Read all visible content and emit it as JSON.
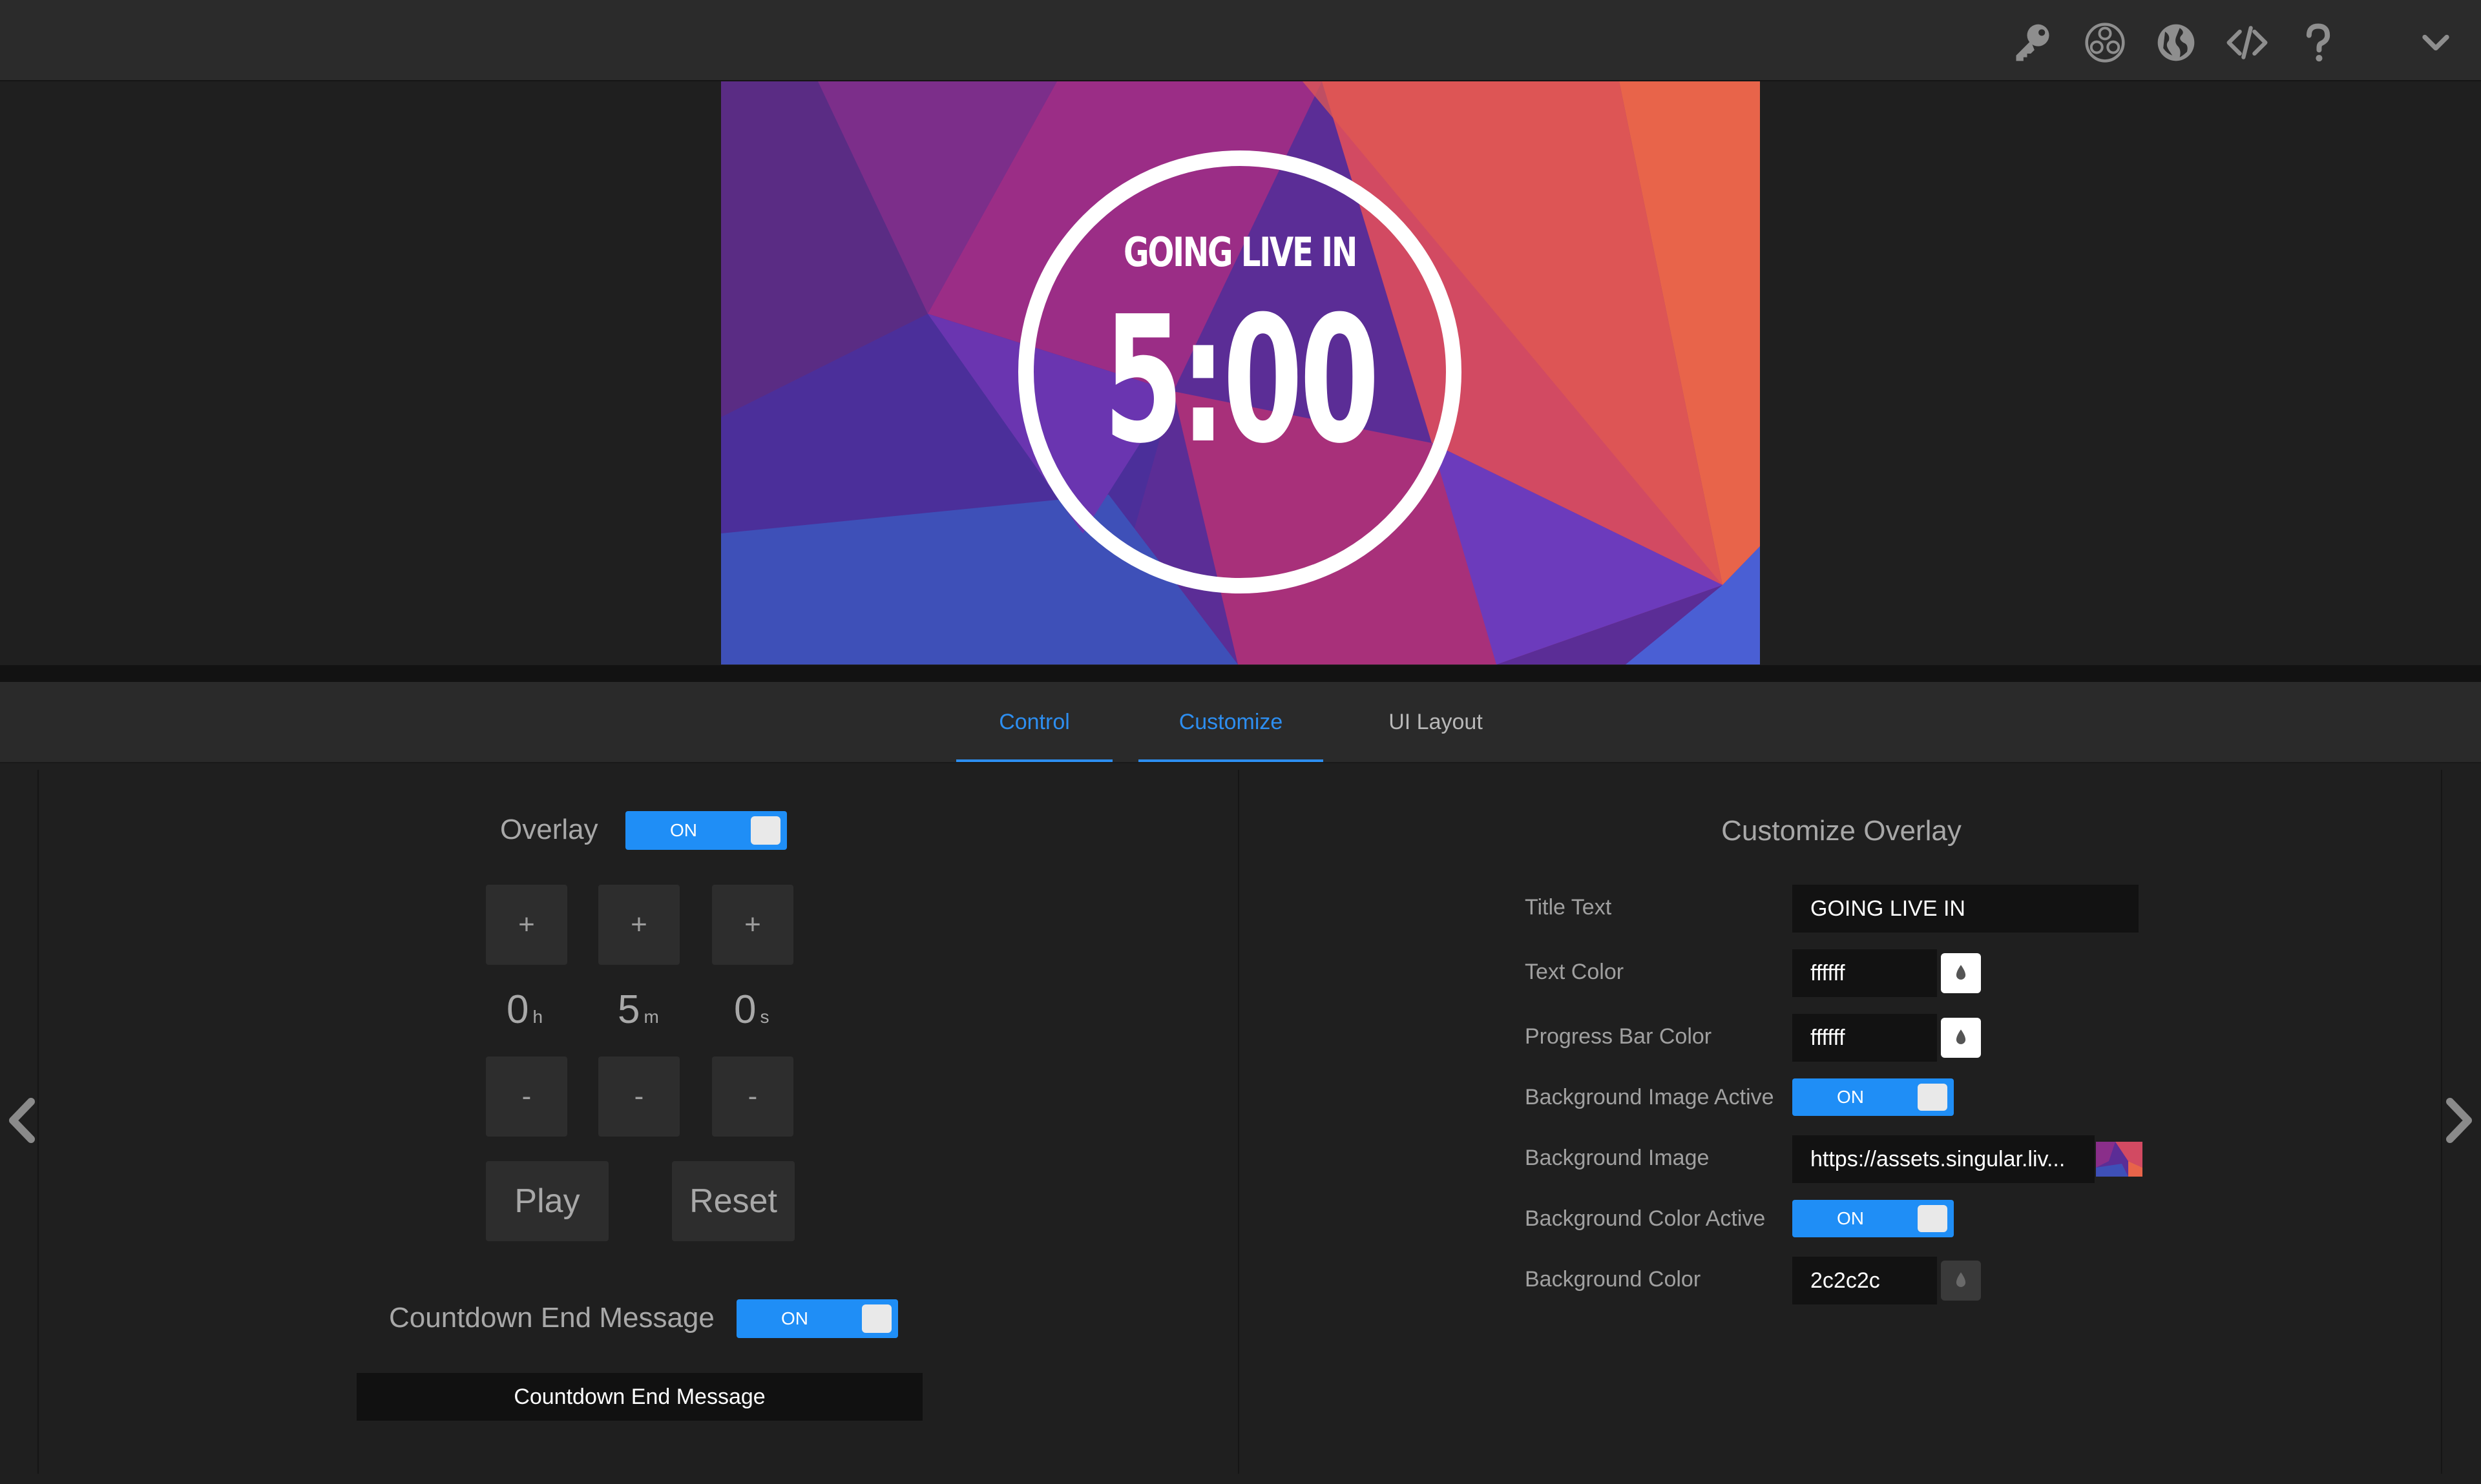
{
  "topbar": {
    "icons": [
      "key-icon",
      "obs-icon",
      "globe-icon",
      "code-icon",
      "help-icon",
      "chevron-down-icon"
    ]
  },
  "preview": {
    "title": "GOING LIVE IN",
    "time": "5:00"
  },
  "tabs": [
    {
      "label": "Control",
      "active": true
    },
    {
      "label": "Customize",
      "active": true
    },
    {
      "label": "UI Layout",
      "active": false
    }
  ],
  "control": {
    "overlay_label": "Overlay",
    "overlay_toggle": "ON",
    "plus": "+",
    "minus": "-",
    "hours": {
      "value": "0",
      "unit": "h"
    },
    "minutes": {
      "value": "5",
      "unit": "m"
    },
    "seconds": {
      "value": "0",
      "unit": "s"
    },
    "play_label": "Play",
    "reset_label": "Reset",
    "end_message_label": "Countdown End Message",
    "end_message_toggle": "ON",
    "end_message_value": "Countdown End Message"
  },
  "customize": {
    "title": "Customize Overlay",
    "title_text_label": "Title Text",
    "title_text_value": "GOING LIVE IN",
    "text_color_label": "Text Color",
    "text_color_value": "ffffff",
    "progress_bar_color_label": "Progress Bar Color",
    "progress_bar_color_value": "ffffff",
    "bg_image_active_label": "Background Image Active",
    "bg_image_active_toggle": "ON",
    "bg_image_label": "Background Image",
    "bg_image_value": "https://assets.singular.liv...",
    "bg_color_active_label": "Background Color Active",
    "bg_color_active_toggle": "ON",
    "bg_color_label": "Background Color",
    "bg_color_value": "2c2c2c"
  },
  "colors": {
    "accent": "#1f8ef6",
    "panel_bg": "#1f1f1f",
    "topbar_bg": "#2b2b2b"
  }
}
